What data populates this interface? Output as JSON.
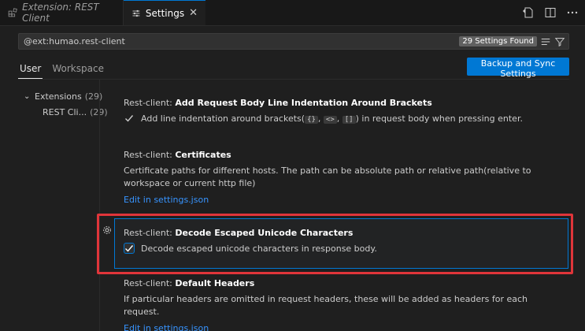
{
  "tabs": [
    {
      "label": "Extension: REST Client",
      "active": false
    },
    {
      "label": "Settings",
      "active": true
    }
  ],
  "search": {
    "value": "@ext:humao.rest-client",
    "count": "29 Settings Found"
  },
  "scope_tabs": [
    "User",
    "Workspace"
  ],
  "sync_button": "Backup and Sync Settings",
  "toc": {
    "group": {
      "label": "Extensions",
      "count": "(29)"
    },
    "item": {
      "label": "REST Cli...",
      "count": "(29)"
    }
  },
  "settings": [
    {
      "category": "Rest-client: ",
      "name": "Add Request Body Line Indentation Around Brackets",
      "check_prefix": "Add line indentation around brackets(",
      "codes": [
        "{}",
        "<>",
        "[]"
      ],
      "check_suffix": ") in request body when pressing enter."
    },
    {
      "category": "Rest-client: ",
      "name": "Certificates",
      "description": "Certificate paths for different hosts. The path can be absolute path or relative path(relative to workspace or current http file)",
      "link": "Edit in settings.json"
    },
    {
      "category": "Rest-client: ",
      "name": "Decode Escaped Unicode Characters",
      "check_text": "Decode escaped unicode characters in response body."
    },
    {
      "category": "Rest-client: ",
      "name": "Default Headers",
      "description": "If particular headers are omitted in request headers, these will be added as headers for each request.",
      "link": "Edit in settings.json"
    }
  ],
  "colors": {
    "accent": "#0078d4",
    "highlight": "#e0353a",
    "link": "#3794ff"
  }
}
